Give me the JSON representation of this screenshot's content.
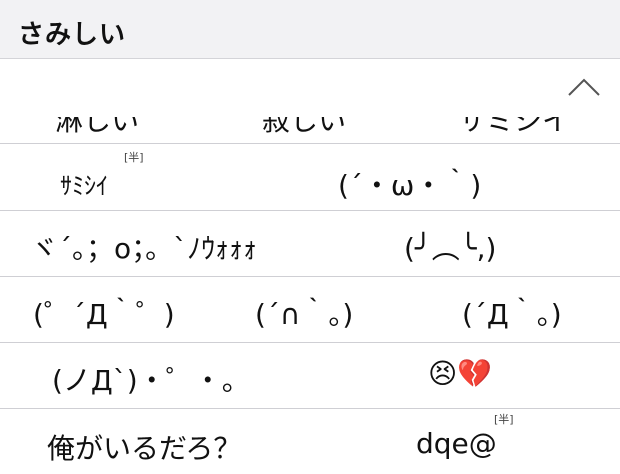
{
  "input": {
    "text": "さみしい"
  },
  "controls": {
    "collapse_icon": "chevron-up-icon"
  },
  "rows": [
    {
      "cells": [
        {
          "text": "淋しい"
        },
        {
          "text": "寂しい"
        },
        {
          "text": "サミシイ"
        }
      ]
    },
    {
      "cells": [
        {
          "text": "ｻﾐｼｲ",
          "badge": "[半]"
        },
        {
          "text": "(´・ω・｀)"
        }
      ]
    },
    {
      "cells": [
        {
          "text": "ヾ´。；o；。`ﾉｳｫｫｫ"
        },
        {
          "text": "(╯︵╰,)"
        }
      ]
    },
    {
      "cells": [
        {
          "text": "(゜´Д｀゜)"
        },
        {
          "text": "(´∩｀。)"
        },
        {
          "text": "(´Д｀。)"
        }
      ]
    },
    {
      "cells": [
        {
          "text": "(ノД`)・゜・。"
        },
        {
          "text": "😣💔"
        }
      ]
    },
    {
      "cells": [
        {
          "text": "俺がいるだろ？"
        },
        {
          "text": "dqe@",
          "badge": "[半]"
        }
      ]
    }
  ]
}
